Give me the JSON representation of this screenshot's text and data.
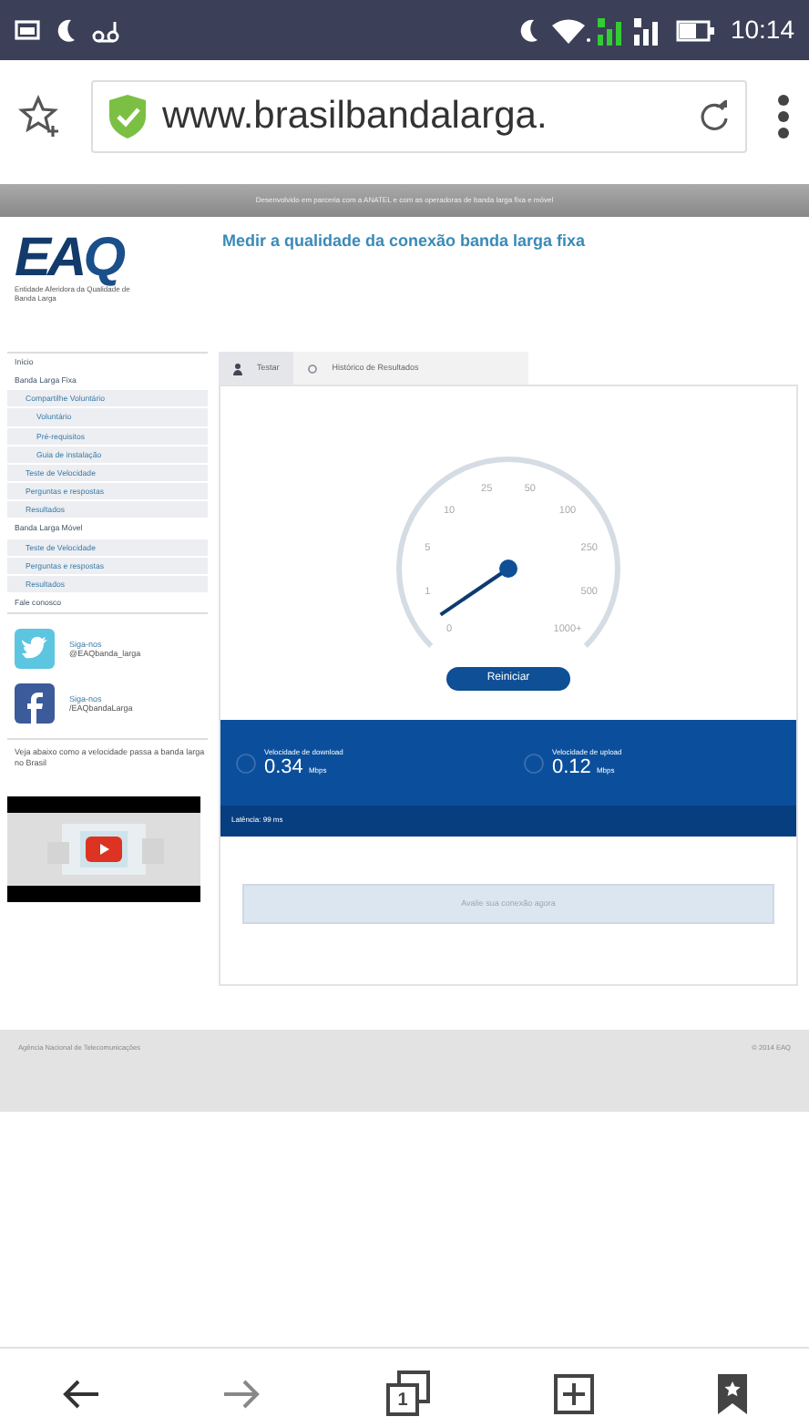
{
  "status_bar": {
    "time": "10:14"
  },
  "browser": {
    "url": "www.brasilbandalarga.",
    "secure": true
  },
  "page": {
    "banner": "Desenvolvido em parceria com a ANATEL e com as operadoras de banda larga fixa e móvel",
    "logo": {
      "letters": "EAQ",
      "tagline": "Entidade Aferidora da Qualidade de Banda Larga"
    },
    "title": "Medir a qualidade da conexão banda larga fixa",
    "sidebar": [
      {
        "label": "Início"
      },
      {
        "label": "Banda Larga Fixa",
        "children": [
          {
            "label": "Compartilhe Voluntário",
            "children": [
              {
                "label": "Voluntário"
              },
              {
                "label": "Pré-requisitos"
              },
              {
                "label": "Guia de instalação"
              }
            ]
          },
          {
            "label": "Teste de Velocidade"
          },
          {
            "label": "Perguntas e respostas"
          },
          {
            "label": "Resultados"
          }
        ]
      },
      {
        "label": "Banda Larga Móvel",
        "children": [
          {
            "label": "Teste de Velocidade"
          },
          {
            "label": "Perguntas e respostas"
          },
          {
            "label": "Resultados"
          }
        ]
      },
      {
        "label": "Fale conosco"
      }
    ],
    "social": [
      {
        "kind": "twitter",
        "title": "Siga-nos",
        "handle": "@EAQbanda_larga"
      },
      {
        "kind": "facebook",
        "title": "Siga-nos",
        "handle": "/EAQbandaLarga"
      }
    ],
    "note": "Veja abaixo como a velocidade passa a banda larga no Brasil",
    "tabs": [
      {
        "label": "Testar",
        "selected": true
      },
      {
        "label": "Histórico de Resultados",
        "selected": false
      }
    ],
    "gauge": {
      "ticks": [
        "0",
        "1",
        "5",
        "10",
        "25",
        "50",
        "100",
        "250",
        "500",
        "1000+"
      ]
    },
    "restart_button": "Reiniciar",
    "results": [
      {
        "label": "Velocidade de download",
        "value": "0.34",
        "unit": "Mbps"
      },
      {
        "label": "Velocidade de upload",
        "value": "0.12",
        "unit": "Mbps"
      }
    ],
    "latency": "Latência: 99 ms",
    "evaluate_button": "Avalie sua conexão agora",
    "footer": {
      "left": "Agência Nacional de Telecomunicações",
      "right": "© 2014 EAQ"
    }
  },
  "bottom_nav": {
    "tab_count": "1"
  }
}
